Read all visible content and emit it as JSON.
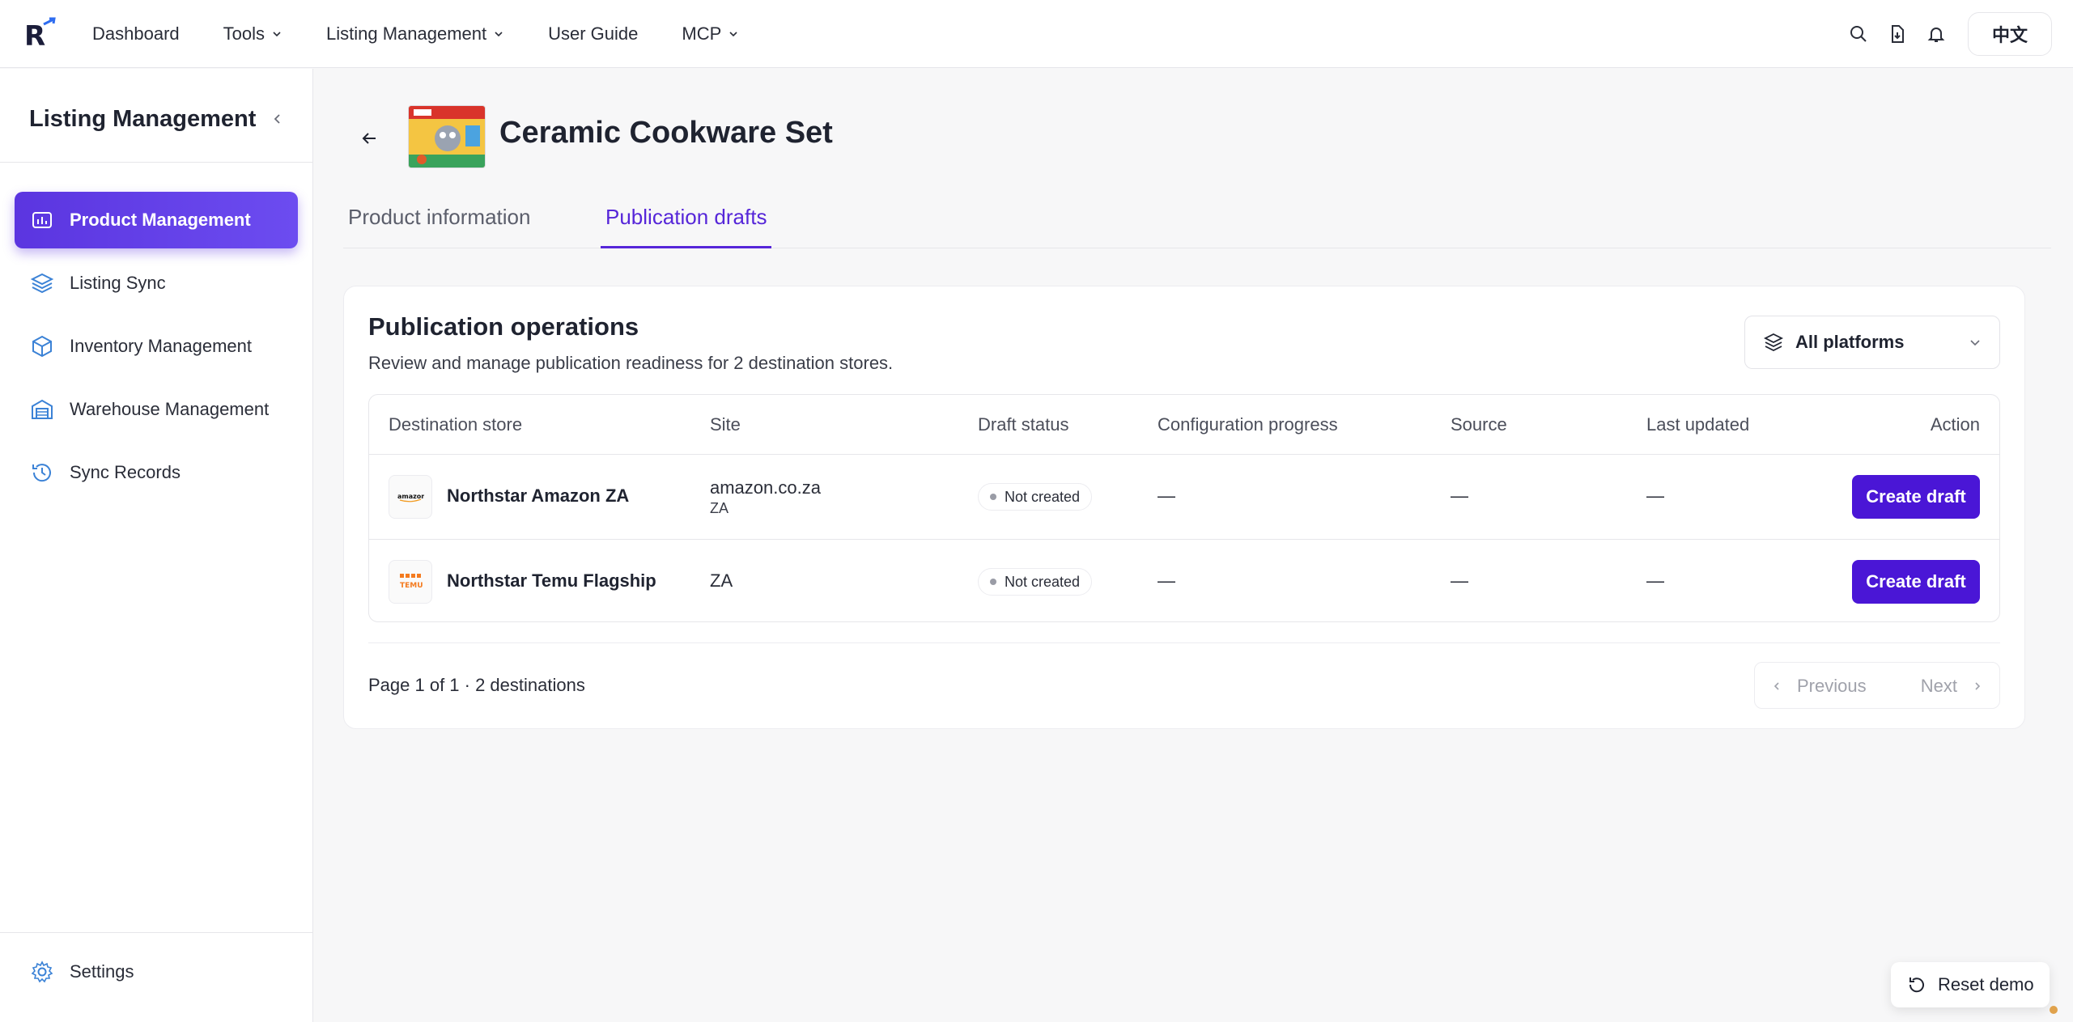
{
  "topnav": {
    "logo_letter": "R",
    "items": [
      {
        "label": "Dashboard",
        "has_dropdown": false
      },
      {
        "label": "Tools",
        "has_dropdown": true
      },
      {
        "label": "Listing Management",
        "has_dropdown": true
      },
      {
        "label": "User Guide",
        "has_dropdown": false
      },
      {
        "label": "MCP",
        "has_dropdown": true
      }
    ],
    "right_icons": [
      "search-icon",
      "document-download-icon",
      "bell-icon"
    ],
    "lang_label": "中文"
  },
  "sidebar": {
    "title": "Listing Management",
    "items": [
      {
        "label": "Product Management",
        "icon": "product-chart-icon",
        "active": true
      },
      {
        "label": "Listing Sync",
        "icon": "layers-icon",
        "active": false
      },
      {
        "label": "Inventory Management",
        "icon": "box-icon",
        "active": false
      },
      {
        "label": "Warehouse Management",
        "icon": "warehouse-icon",
        "active": false
      },
      {
        "label": "Sync Records",
        "icon": "history-icon",
        "active": false
      }
    ],
    "settings_label": "Settings"
  },
  "page": {
    "title": "Ceramic Cookware Set",
    "tabs": [
      {
        "label": "Product information",
        "active": false
      },
      {
        "label": "Publication drafts",
        "active": true
      }
    ]
  },
  "card": {
    "title": "Publication operations",
    "subtitle": "Review and manage publication readiness for 2 destination stores.",
    "platform_filter": "All platforms",
    "columns": [
      "Destination store",
      "Site",
      "Draft status",
      "Configuration progress",
      "Source",
      "Last updated",
      "Action"
    ],
    "rows": [
      {
        "store": "Northstar Amazon ZA",
        "store_logo": "amazon",
        "site_main": "amazon.co.za",
        "site_sub": "ZA",
        "status": "Not created",
        "config_progress": "—",
        "source": "—",
        "last_updated": "—",
        "action": "Create draft"
      },
      {
        "store": "Northstar Temu Flagship",
        "store_logo": "TEMU",
        "site_main": "ZA",
        "site_sub": "",
        "status": "Not created",
        "config_progress": "—",
        "source": "—",
        "last_updated": "—",
        "action": "Create draft"
      }
    ],
    "pagination_text": "Page 1 of 1 · 2 destinations",
    "prev_label": "Previous",
    "next_label": "Next"
  },
  "reset_label": "Reset demo",
  "colors": {
    "accent": "#4a16d6",
    "active_tab": "#5626d9",
    "sidebar_active": "#5b35e0"
  }
}
